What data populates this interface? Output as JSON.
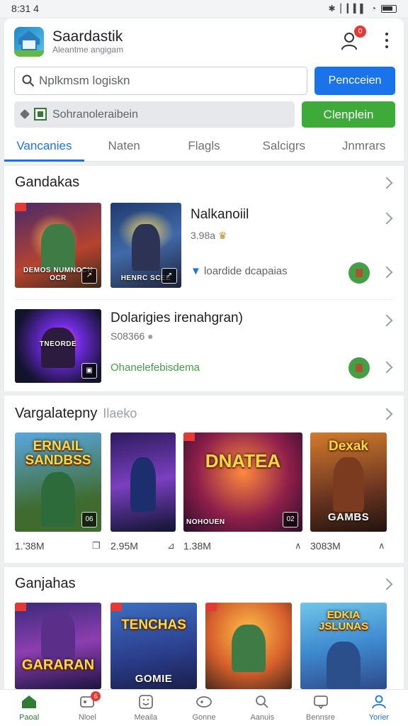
{
  "status_bar": {
    "time": "8:31 4"
  },
  "header": {
    "app_title": "Saardastik",
    "app_subtitle": "Aleantme angigam",
    "notification_count": "0"
  },
  "search": {
    "placeholder": "Nplkmsm logiskn",
    "button_label": "Pencceien"
  },
  "filter": {
    "label": "Sohranoleraibein",
    "button_label": "Clenplein"
  },
  "tabs": [
    {
      "label": "Vancanies",
      "active": true
    },
    {
      "label": "Naten",
      "active": false
    },
    {
      "label": "Flagls",
      "active": false
    },
    {
      "label": "Salcigrs",
      "active": false
    },
    {
      "label": "Jnmrars",
      "active": false
    }
  ],
  "section1": {
    "title": "Gandakas",
    "item1": {
      "title": "Nalkanoiil",
      "meta": "3.98a",
      "link": "loardide dcapaias",
      "link_color": "#5f6368",
      "art_captions": [
        "DEMOS NUMNOCH OCR",
        "HENRC SCEE"
      ]
    },
    "item2": {
      "title": "Dolarigies irenahgran)",
      "meta": "S08366",
      "link": "Ohanelefebisdema",
      "link_color": "#43a047",
      "art_captions": [
        "TNEORDE"
      ]
    }
  },
  "section2": {
    "title": "Vargalatepny",
    "subtitle": "Ilaeko",
    "games": [
      {
        "art_title": "ERNAIL SANDBSS",
        "corner": "06",
        "size": "1.'38M",
        "size_icon": "❐"
      },
      {
        "art_title": "",
        "corner": "",
        "size": "2.95M",
        "size_icon": "⊿"
      },
      {
        "art_title": "DNATEA",
        "corner": "02",
        "caption": "NOHOUEN",
        "size": "1.38M",
        "size_icon": "∧"
      },
      {
        "art_title": "Dexak",
        "corner": "",
        "caption": "GAMBS",
        "size": "3083M",
        "size_icon": "∧"
      }
    ]
  },
  "section3": {
    "title": "Ganjahas",
    "games": [
      {
        "art_title": "GARARAN"
      },
      {
        "art_title": "TENCHAS",
        "caption": "GOMIE"
      },
      {
        "art_title": ""
      },
      {
        "art_title": "EDKIA JSLUNAS"
      }
    ]
  },
  "bottom_nav": [
    {
      "label": "Paoal",
      "icon": "home-icon",
      "active": false,
      "badge": ""
    },
    {
      "label": "Nloel",
      "icon": "gamepad-icon",
      "active": false,
      "badge": "6"
    },
    {
      "label": "Meaila",
      "icon": "smile-icon",
      "active": false,
      "badge": ""
    },
    {
      "label": "Gonne",
      "icon": "controller-icon",
      "active": false,
      "badge": ""
    },
    {
      "label": "Aanuis",
      "icon": "search-icon",
      "active": false,
      "badge": ""
    },
    {
      "label": "Bennsre",
      "icon": "chat-icon",
      "active": false,
      "badge": ""
    },
    {
      "label": "Yorier",
      "icon": "profile-icon",
      "active": true,
      "badge": ""
    }
  ]
}
